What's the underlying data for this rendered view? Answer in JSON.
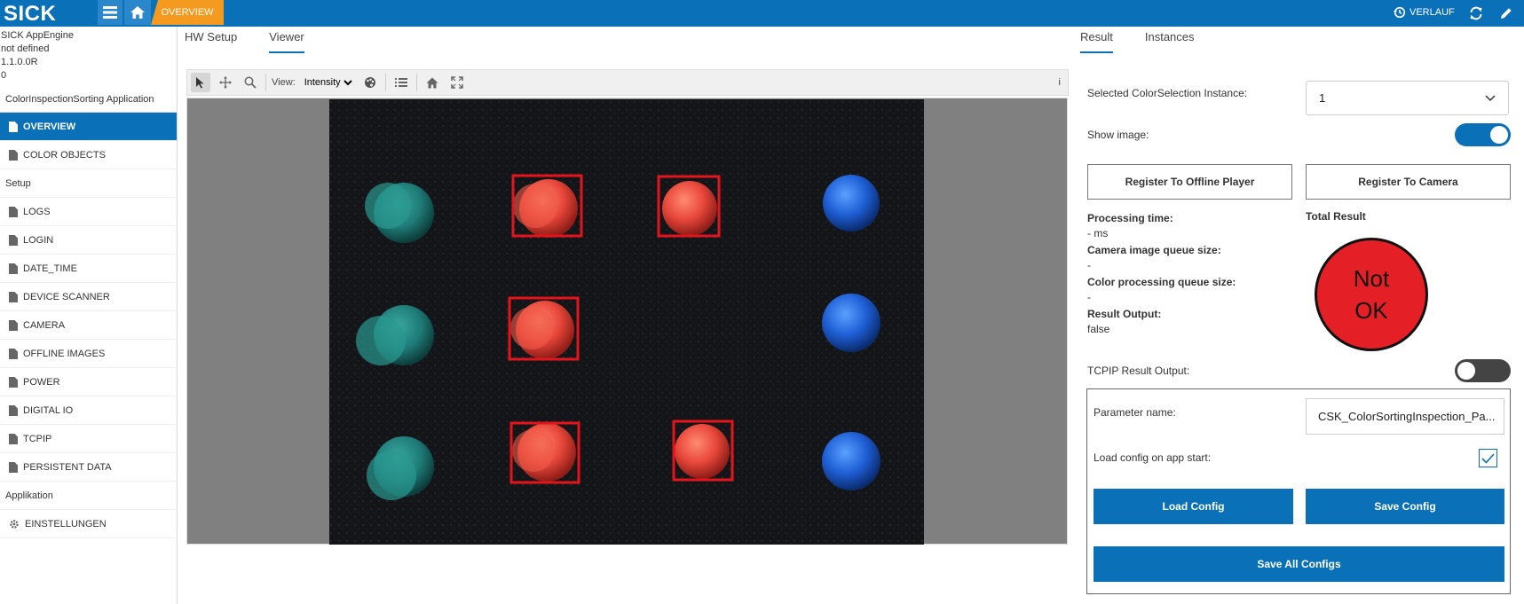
{
  "topbar": {
    "logo": "SICK",
    "breadcrumb": "OVERVIEW",
    "history_label": "VERLAUF",
    "accent_color": "#0a70b7",
    "crumb_color": "#f49a1f"
  },
  "app_info": {
    "name": "SICK AppEngine",
    "line2": "not defined",
    "version": "1.1.0.0R",
    "line4": "0"
  },
  "sidebar": {
    "app_title": "ColorInspectionSorting Application",
    "top_items": [
      {
        "label": "OVERVIEW",
        "icon": "document-icon",
        "active": true
      },
      {
        "label": "COLOR OBJECTS",
        "icon": "document-icon"
      }
    ],
    "setup_label": "Setup",
    "setup_items": [
      {
        "label": "LOGS"
      },
      {
        "label": "LOGIN"
      },
      {
        "label": "DATE_TIME"
      },
      {
        "label": "DEVICE SCANNER"
      },
      {
        "label": "CAMERA"
      },
      {
        "label": "OFFLINE IMAGES"
      },
      {
        "label": "POWER"
      },
      {
        "label": "DIGITAL IO"
      },
      {
        "label": "TCPIP"
      },
      {
        "label": "PERSISTENT DATA"
      }
    ],
    "app_section_label": "Applikation",
    "settings_label": "EINSTELLUNGEN"
  },
  "left_tabs": [
    {
      "label": "HW Setup",
      "active": false
    },
    {
      "label": "Viewer",
      "active": true
    }
  ],
  "viewer_toolbar": {
    "view_label": "View:",
    "view_value": "Intensity",
    "info": "i"
  },
  "right_tabs": [
    {
      "label": "Result",
      "active": true
    },
    {
      "label": "Instances",
      "active": false
    }
  ],
  "result_panel": {
    "instance_label": "Selected ColorSelection Instance:",
    "instance_value": "1",
    "show_image_label": "Show image:",
    "show_image_on": true,
    "register_offline": "Register To Offline Player",
    "register_camera": "Register To Camera",
    "processing_time_label": "Processing time:",
    "processing_time_value": "- ms",
    "camera_queue_label": "Camera image queue size:",
    "camera_queue_value": "-",
    "color_queue_label": "Color processing queue size:",
    "color_queue_value": "-",
    "result_output_label": "Result Output:",
    "result_output_value": "false",
    "total_result_label": "Total Result",
    "total_result_line1": "Not",
    "total_result_line2": "OK",
    "total_result_color": "#e41f25",
    "tcpip_label": "TCPIP Result Output:",
    "tcpip_on": false
  },
  "config": {
    "param_name_label": "Parameter name:",
    "param_name_value": "CSK_ColorSortingInspection_Pa...",
    "load_on_start_label": "Load config on app start:",
    "load_on_start_checked": true,
    "load_button": "Load Config",
    "save_button": "Save Config",
    "save_all_button": "Save All Configs"
  }
}
